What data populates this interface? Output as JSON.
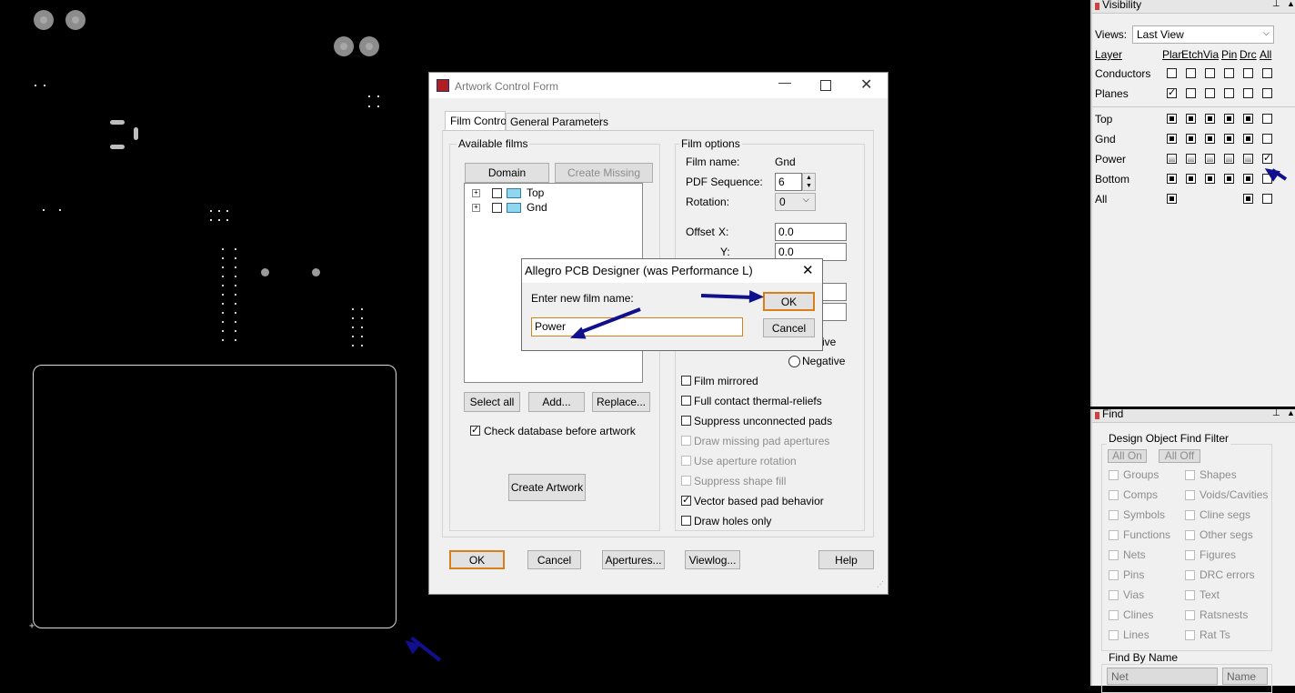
{
  "artwork_form": {
    "title": "Artwork Control Form",
    "tabs": [
      "Film Control",
      "General Parameters"
    ],
    "available_films": {
      "group_label": "Available films",
      "domain_selection": "Domain Selection",
      "create_missing": "Create Missing Films",
      "films": [
        "Top",
        "Gnd"
      ],
      "select_all": "Select all",
      "add": "Add...",
      "replace": "Replace...",
      "check_db": "Check database before artwork",
      "create_artwork": "Create Artwork"
    },
    "film_options": {
      "group_label": "Film options",
      "film_name_label": "Film name:",
      "film_name_value": "Gnd",
      "pdf_seq_label": "PDF Sequence:",
      "pdf_seq_value": "6",
      "rotation_label": "Rotation:",
      "rotation_value": "0",
      "offset_label": "Offset",
      "x_label": "X:",
      "x_value": "0.0",
      "y_label": "Y:",
      "y_value": "0.0",
      "positive_partial": "ive",
      "negative": "Negative",
      "options": [
        {
          "label": "Film mirrored",
          "checked": false,
          "enabled": true
        },
        {
          "label": "Full contact thermal-reliefs",
          "checked": false,
          "enabled": true
        },
        {
          "label": "Suppress unconnected pads",
          "checked": false,
          "enabled": true
        },
        {
          "label": "Draw missing pad apertures",
          "checked": false,
          "enabled": false
        },
        {
          "label": "Use aperture rotation",
          "checked": false,
          "enabled": false
        },
        {
          "label": "Suppress shape fill",
          "checked": false,
          "enabled": false
        },
        {
          "label": "Vector based pad behavior",
          "checked": true,
          "enabled": true
        },
        {
          "label": "Draw holes only",
          "checked": false,
          "enabled": true
        }
      ]
    },
    "buttons": {
      "ok": "OK",
      "cancel": "Cancel",
      "apertures": "Apertures...",
      "viewlog": "Viewlog...",
      "help": "Help"
    }
  },
  "name_dialog": {
    "title": "Allegro PCB Designer (was Performance L)",
    "prompt": "Enter new film name:",
    "value": "Power",
    "ok": "OK",
    "cancel": "Cancel"
  },
  "visibility": {
    "title": "Visibility",
    "views_label": "Views:",
    "views_value": "Last View",
    "headers": [
      "Layer",
      "Plan",
      "Etch",
      "Via",
      "Pin",
      "Drc",
      "All"
    ],
    "groups": [
      {
        "name": "Conductors",
        "states": [
          "empty",
          "empty",
          "empty",
          "empty",
          "empty",
          "empty"
        ]
      },
      {
        "name": "Planes",
        "states": [
          "tick",
          "empty",
          "empty",
          "empty",
          "empty",
          "empty"
        ]
      }
    ],
    "layers": [
      {
        "name": "Top",
        "states": [
          "fill",
          "fill",
          "fill",
          "fill",
          "fill",
          "empty"
        ]
      },
      {
        "name": "Gnd",
        "states": [
          "fill",
          "fill",
          "fill",
          "fill",
          "fill",
          "empty"
        ]
      },
      {
        "name": "Power",
        "states": [
          "grey",
          "grey",
          "grey",
          "grey",
          "grey",
          "tick"
        ]
      },
      {
        "name": "Bottom",
        "states": [
          "fill",
          "fill",
          "fill",
          "fill",
          "fill",
          "empty"
        ]
      },
      {
        "name": "All",
        "states": [
          "fill",
          "none",
          "none",
          "none",
          "fill",
          "empty"
        ]
      }
    ]
  },
  "find": {
    "title": "Find",
    "filter_label": "Design Object Find Filter",
    "all_on": "All On",
    "all_off": "All Off",
    "left_items": [
      "Groups",
      "Comps",
      "Symbols",
      "Functions",
      "Nets",
      "Pins",
      "Vias",
      "Clines",
      "Lines"
    ],
    "right_items": [
      "Shapes",
      "Voids/Cavities",
      "Cline segs",
      "Other segs",
      "Figures",
      "DRC errors",
      "Text",
      "Ratsnests",
      "Rat Ts"
    ],
    "find_by_name": "Find By Name",
    "type_value": "Net",
    "mode_value": "Name"
  }
}
